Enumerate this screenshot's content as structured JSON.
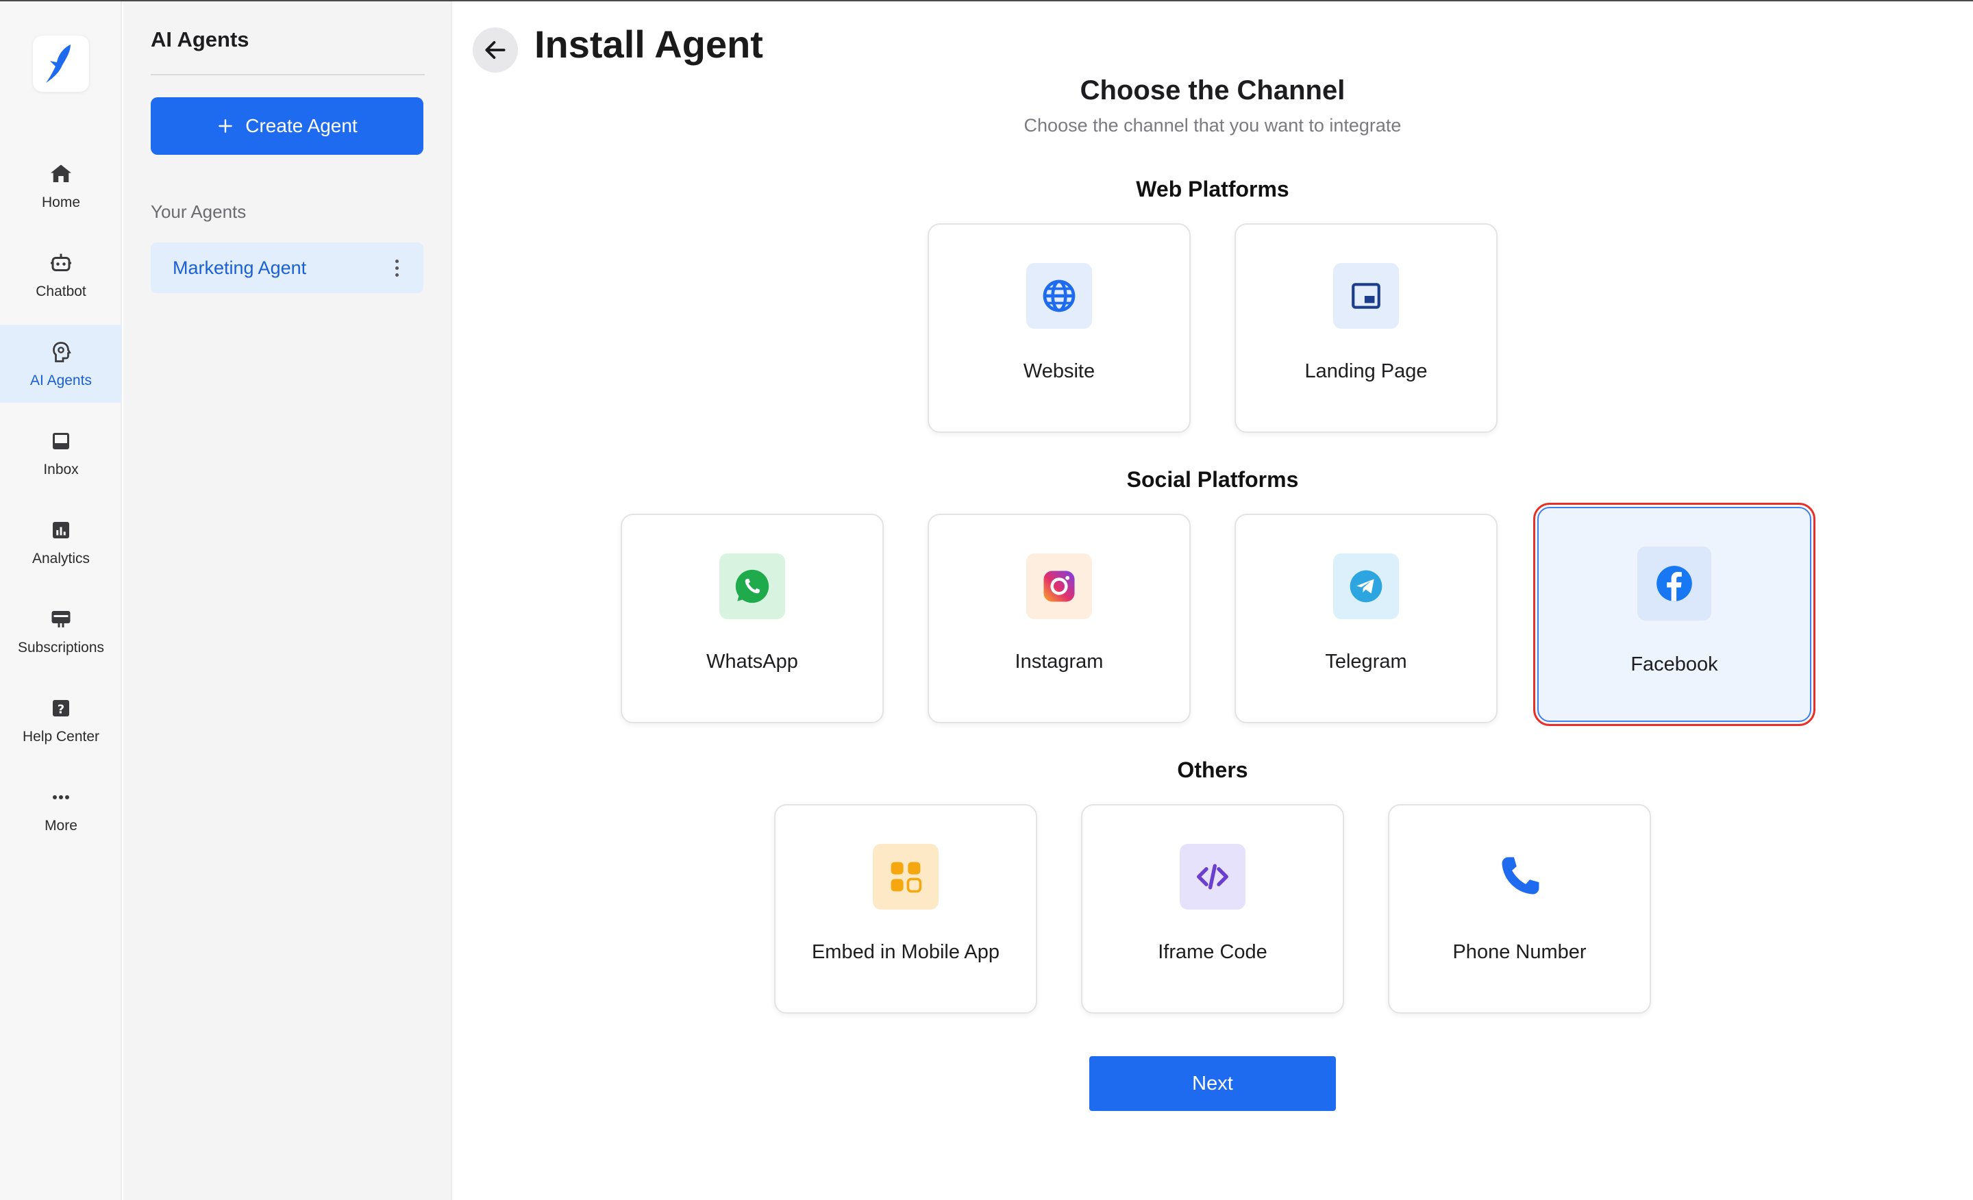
{
  "nav": {
    "items": [
      {
        "label": "Home",
        "icon": "home-icon"
      },
      {
        "label": "Chatbot",
        "icon": "robot-icon"
      },
      {
        "label": "AI Agents",
        "icon": "ai-head-icon",
        "active": true
      },
      {
        "label": "Inbox",
        "icon": "inbox-icon"
      },
      {
        "label": "Analytics",
        "icon": "analytics-icon"
      },
      {
        "label": "Subscriptions",
        "icon": "subscriptions-icon"
      },
      {
        "label": "Help Center",
        "icon": "help-icon"
      },
      {
        "label": "More",
        "icon": "more-icon"
      }
    ]
  },
  "panel": {
    "title": "AI Agents",
    "create_label": "Create Agent",
    "your_agents_label": "Your Agents",
    "agents": [
      {
        "name": "Marketing Agent"
      }
    ]
  },
  "main": {
    "title": "Install Agent",
    "heading": "Choose the Channel",
    "subheading": "Choose the channel that you want to integrate",
    "groups": [
      {
        "label": "Web Platforms",
        "channels": [
          {
            "name": "Website",
            "icon": "globe-icon"
          },
          {
            "name": "Landing Page",
            "icon": "landing-page-icon"
          }
        ]
      },
      {
        "label": "Social Platforms",
        "channels": [
          {
            "name": "WhatsApp",
            "icon": "whatsapp-icon"
          },
          {
            "name": "Instagram",
            "icon": "instagram-icon"
          },
          {
            "name": "Telegram",
            "icon": "telegram-icon"
          },
          {
            "name": "Facebook",
            "icon": "facebook-icon",
            "selected": true
          }
        ]
      },
      {
        "label": "Others",
        "channels": [
          {
            "name": "Embed in Mobile App",
            "icon": "apps-grid-icon"
          },
          {
            "name": "Iframe Code",
            "icon": "code-icon"
          },
          {
            "name": "Phone Number",
            "icon": "phone-icon"
          }
        ]
      }
    ],
    "next_label": "Next"
  },
  "colors": {
    "accent": "#1f6bf0",
    "active_bg": "#e3eefc",
    "selected_outline": "#e8302a",
    "whatsapp": "#1faa4b",
    "telegram": "#2ca5e0",
    "facebook": "#1877f2"
  }
}
